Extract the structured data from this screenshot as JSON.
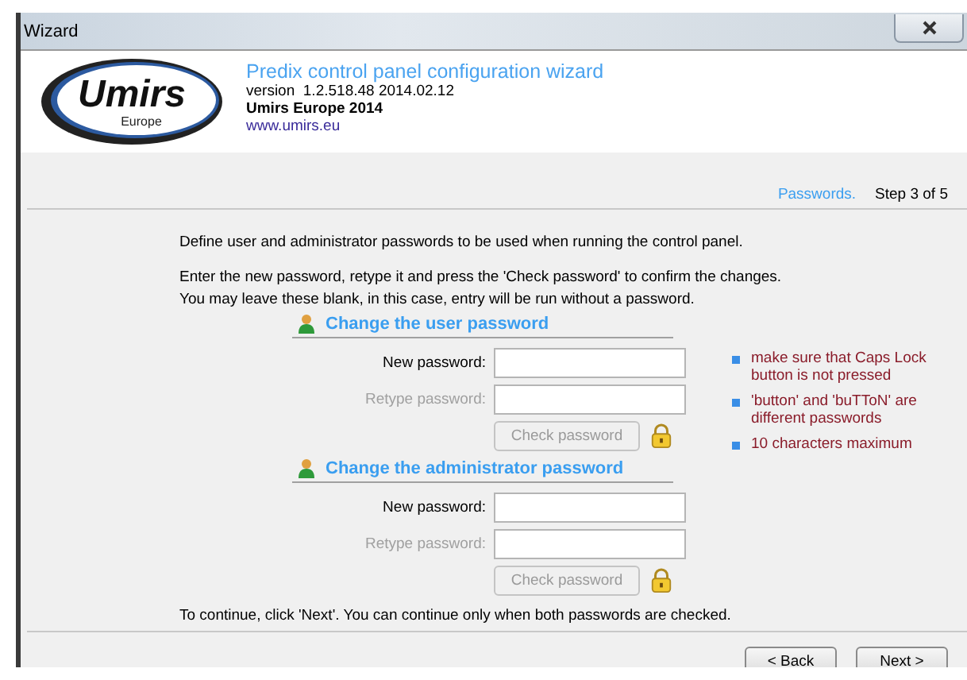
{
  "window": {
    "title": "Wizard"
  },
  "header": {
    "logo": {
      "name": "Umirs",
      "region": "Europe"
    },
    "title": "Predix control panel configuration wizard",
    "version": "version  1.2.518.48 2014.02.12",
    "company": "Umirs Europe 2014",
    "link": "www.umirs.eu"
  },
  "step": {
    "name": "Passwords.",
    "progress": "Step 3 of 5"
  },
  "intro": [
    "Define user and administrator passwords to be used when running the control panel.",
    "Enter the new password, retype it and press the 'Check password' to confirm the changes.",
    "You may leave these blank, in this case, entry will be run without a password."
  ],
  "sections": [
    {
      "title": "Change the user password",
      "fields": [
        {
          "label": "New password:",
          "disabled": false
        },
        {
          "label": "Retype password:",
          "disabled": true
        }
      ],
      "check_button": {
        "label": "Check password",
        "disabled": true
      }
    },
    {
      "title": "Change the administrator password",
      "fields": [
        {
          "label": "New password:",
          "disabled": false
        },
        {
          "label": "Retype password:",
          "disabled": true
        }
      ],
      "check_button": {
        "label": "Check password",
        "disabled": true
      }
    }
  ],
  "notes": [
    "make sure that Caps Lock button is not pressed",
    "'button' and 'buTToN' are different passwords",
    "10 characters maximum"
  ],
  "footer_text": "To continue, click 'Next'. You can continue only when both passwords are checked.",
  "buttons": [
    {
      "label": "< Back",
      "disabled": false
    },
    {
      "label": "Next >",
      "disabled": false
    }
  ]
}
